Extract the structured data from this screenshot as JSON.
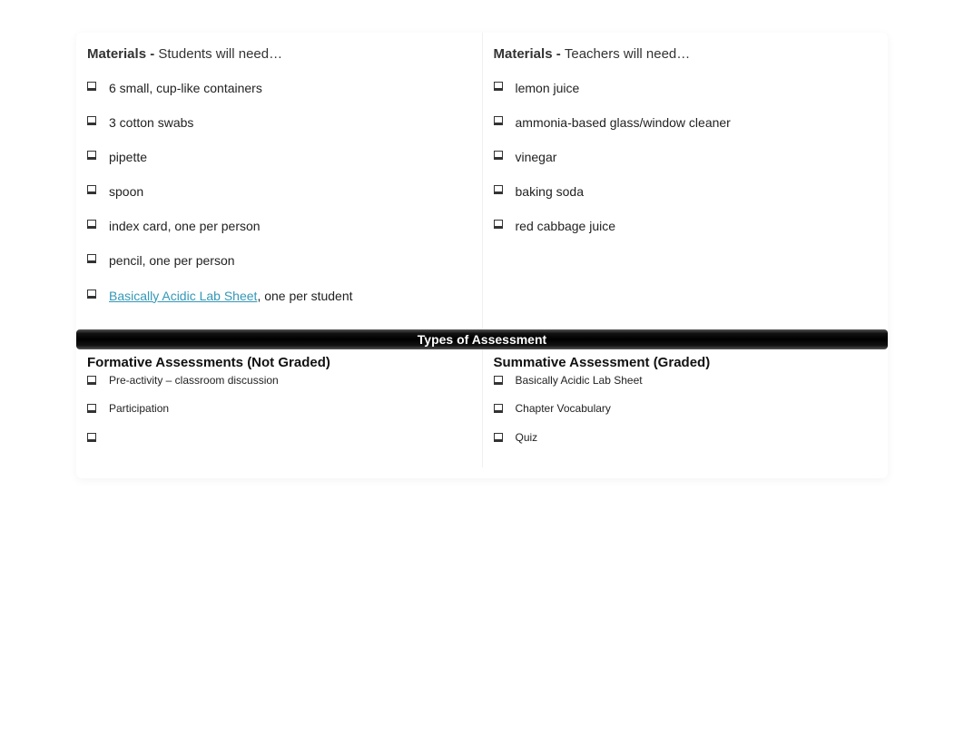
{
  "materials": {
    "students": {
      "label_bold": "Materials - ",
      "label_rest": "Students will need…",
      "items": [
        {
          "text": "6 small, cup-like containers"
        },
        {
          "text": "3 cotton swabs"
        },
        {
          "text": "pipette"
        },
        {
          "text": "spoon"
        },
        {
          "text": "index card, one per person"
        },
        {
          "text": "pencil, one per person"
        }
      ],
      "link_item": {
        "link_text": "Basically Acidic Lab Sheet",
        "suffix": ", one per student"
      }
    },
    "teachers": {
      "label_bold": "Materials - ",
      "label_rest": "Teachers will need…",
      "items": [
        {
          "text": "lemon juice"
        },
        {
          "text": "ammonia-based glass/window cleaner"
        },
        {
          "text": "vinegar"
        },
        {
          "text": "baking soda"
        },
        {
          "text": "red cabbage juice"
        }
      ]
    }
  },
  "banner": {
    "title": "Types of Assessment"
  },
  "assessments": {
    "formative": {
      "heading": "Formative Assessments (Not Graded)",
      "items": [
        {
          "text": "Pre-activity – classroom discussion"
        },
        {
          "text": "Participation"
        },
        {
          "text": ""
        }
      ]
    },
    "summative": {
      "heading": "Summative Assessment (Graded)",
      "items": [
        {
          "text": "Basically Acidic Lab Sheet"
        },
        {
          "text": "Chapter Vocabulary"
        },
        {
          "text": "Quiz"
        }
      ]
    }
  }
}
